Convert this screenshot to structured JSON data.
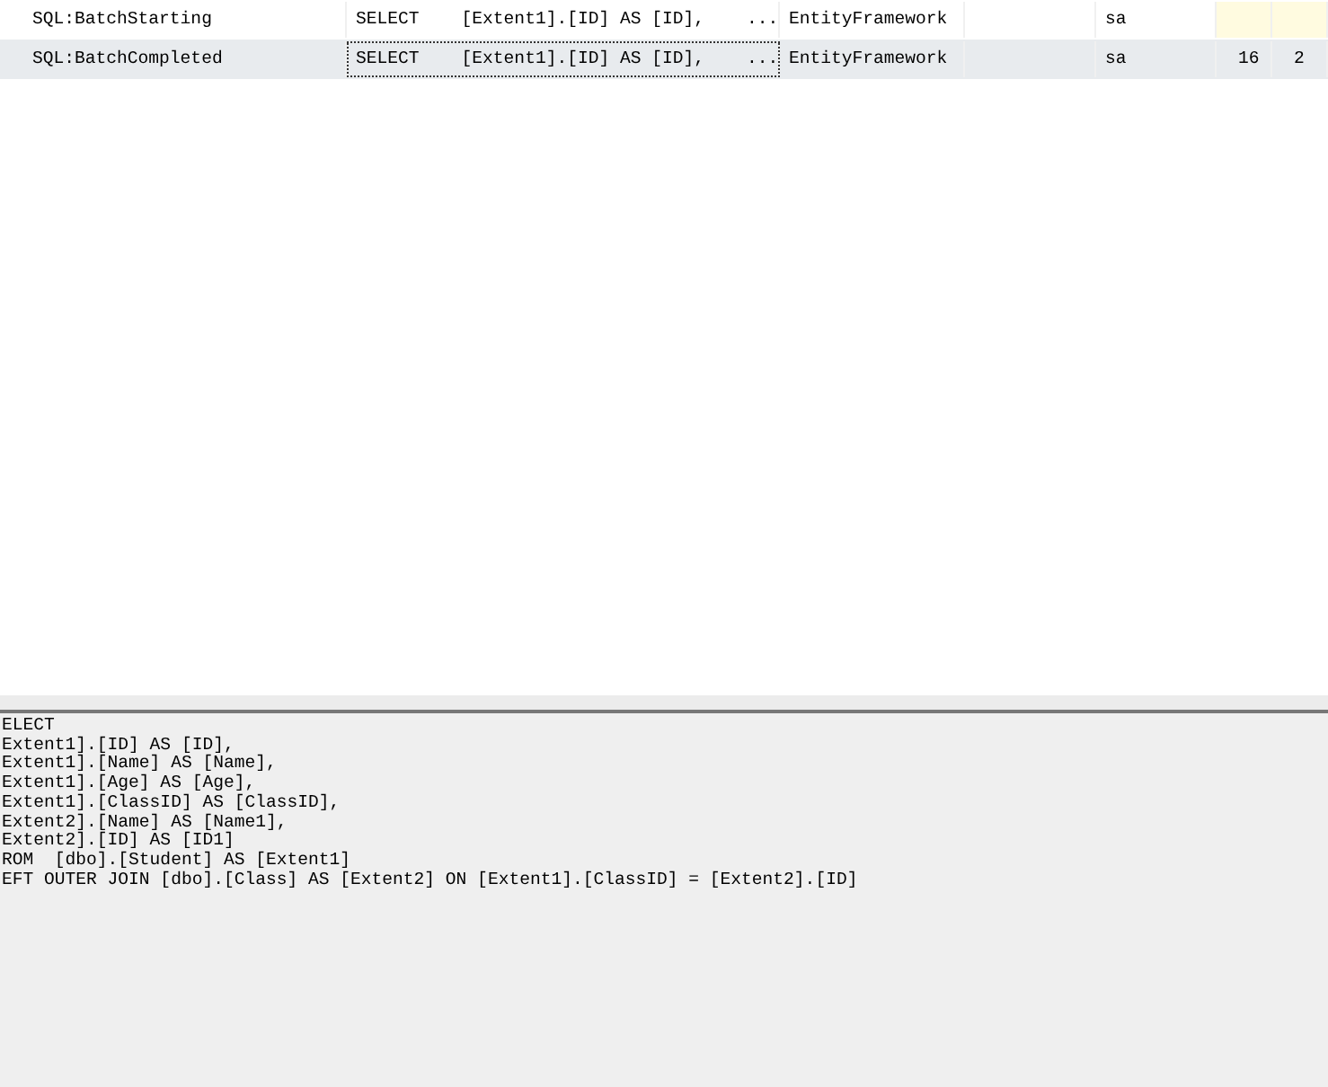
{
  "trace_grid": {
    "rows": [
      {
        "selected": false,
        "cells": [
          {
            "text": "SQL:BatchStarting",
            "focused": false,
            "highlighted": false
          },
          {
            "text": "SELECT    [Extent1].[ID] AS [ID],    ...",
            "focused": false,
            "highlighted": false
          },
          {
            "text": "EntityFramework",
            "focused": false,
            "highlighted": false
          },
          {
            "focused": false,
            "highlighted": false
          },
          {
            "text": "sa",
            "focused": false,
            "highlighted": false
          },
          {
            "focused": false,
            "highlighted": true
          },
          {
            "focused": false,
            "highlighted": true
          }
        ]
      },
      {
        "selected": true,
        "cells": [
          {
            "text": "SQL:BatchCompleted",
            "focused": false,
            "highlighted": false
          },
          {
            "text": "SELECT    [Extent1].[ID] AS [ID],    ...",
            "focused": true,
            "highlighted": false
          },
          {
            "text": "EntityFramework",
            "focused": false,
            "highlighted": false
          },
          {
            "focused": false,
            "highlighted": false
          },
          {
            "text": "sa",
            "focused": false,
            "highlighted": false
          },
          {
            "text": "16",
            "focused": false,
            "highlighted": false
          },
          {
            "text": "2",
            "focused": false,
            "highlighted": false
          }
        ]
      }
    ]
  },
  "sql_text": [
    "ELECT",
    "Extent1].[ID] AS [ID],",
    "Extent1].[Name] AS [Name],",
    "Extent1].[Age] AS [Age],",
    "Extent1].[ClassID] AS [ClassID],",
    "Extent2].[Name] AS [Name1],",
    "Extent2].[ID] AS [ID1]",
    "ROM  [dbo].[Student] AS [Extent1]",
    "EFT OUTER JOIN [dbo].[Class] AS [Extent2] ON [Extent1].[ClassID] = [Extent2].[ID]"
  ]
}
